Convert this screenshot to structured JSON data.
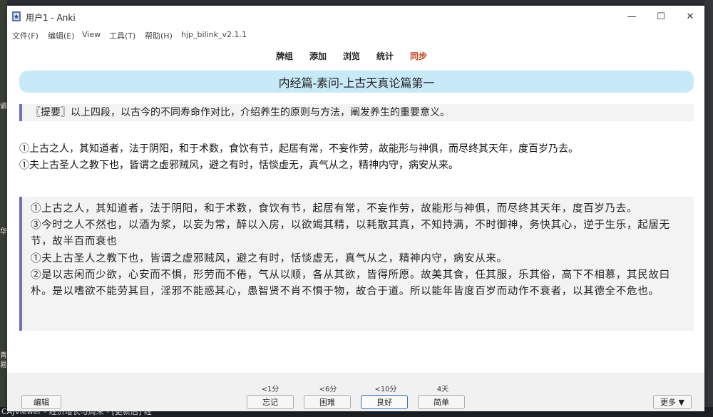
{
  "window": {
    "title": "用户1 - Anki",
    "controls": {
      "minimize": "—",
      "maximize": "☐",
      "close": "✕"
    }
  },
  "menu": [
    "文件(F)",
    "编辑(E)",
    "View",
    "工具(T)",
    "帮助(H)",
    "hjp_bilink_v2.1.1"
  ],
  "toolbar": {
    "decks": "牌组",
    "add": "添加",
    "browse": "浏览",
    "stats": "统计",
    "sync": "同步",
    "sync_color": "#c0451f"
  },
  "card": {
    "heading": "内经篇-素问-上古天真论篇第一",
    "summary": "〖提要〗以上四段，以古今的不同寿命作对比，介绍养生的原则与方法，阐发养生的重要意义。",
    "lines": [
      "①上古之人，其知道者，法于阴阳，和于术数，食饮有节，起居有常，不妄作劳，故能形与神俱，而尽终其天年，度百岁乃去。",
      "①夫上古圣人之教下也，皆谓之虚邪贼风，避之有时，恬惔虚无，真气从之，精神内守，病安从来。"
    ],
    "quote": [
      "①上古之人，其知道者，法于阴阳，和于术数，食饮有节，起居有常，不妄作劳，故能形与神俱，而尽终其天年，度百岁乃去。",
      "③今时之人不然也，以酒为浆，以妄为常，醉以入房，以欲竭其精，以耗散其真，不知持满，不时御神，务快其心，逆于生乐，起居无节，故半百而衰也",
      "①夫上古圣人之教下也，皆谓之虚邪贼风，避之有时，恬惔虚无，真气从之，精神内守，病安从来。",
      "②是以志闲而少欲，心安而不惧，形劳而不倦，气从以顺，各从其欲，皆得所愿。故美其食，任其服，乐其俗，高下不相慕，其民故曰朴。是以嗜欲不能劳其目，淫邪不能惑其心，愚智贤不肖不惧于物，故合于道。所以能年皆度百岁而动作不衰者，以其德全不危也。"
    ],
    "accent": "#6b74b8",
    "heading_bg": "#c8e9f7"
  },
  "answer_bar": {
    "edit": "编辑",
    "more": "更多 ▼",
    "buttons": [
      {
        "interval": "<1分",
        "label": "忘记"
      },
      {
        "interval": "<6分",
        "label": "困难"
      },
      {
        "interval": "<10分",
        "label": "良好"
      },
      {
        "interval": "4天",
        "label": "简单"
      }
    ]
  },
  "desktop": {
    "left_fragments": [
      "谕",
      "华",
      "青",
      "易"
    ],
    "taskbar_text": "CAJViewer - 经济增长与周末 - [更新后] 经"
  }
}
